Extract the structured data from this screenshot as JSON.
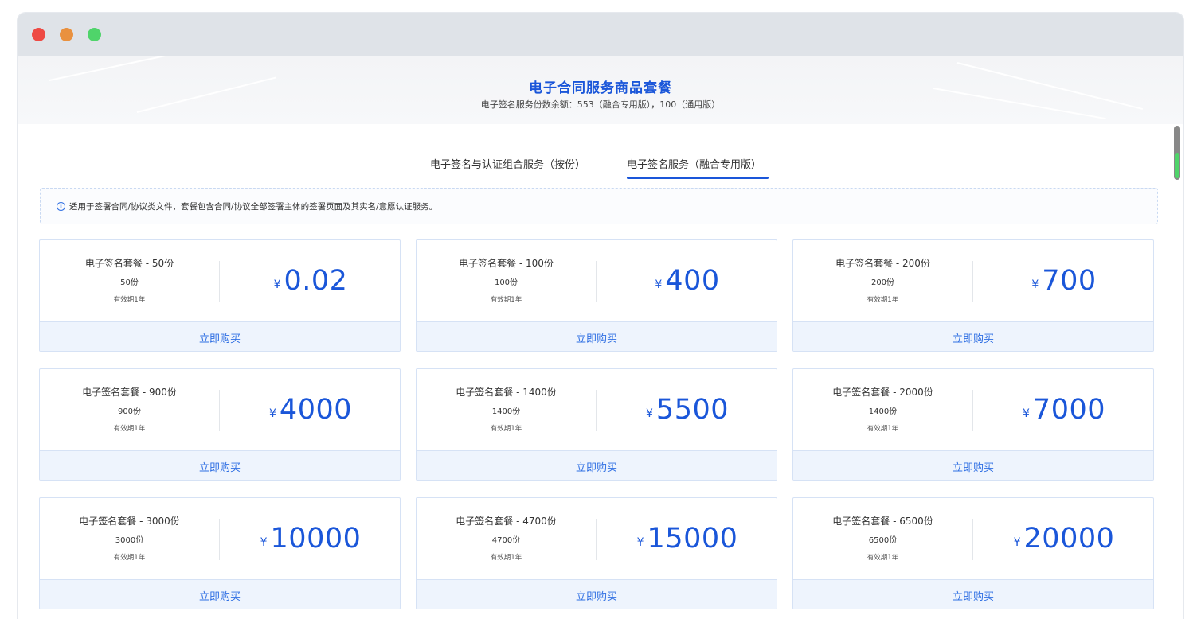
{
  "window": {
    "controls": [
      "close",
      "minimize",
      "maximize"
    ]
  },
  "banner": {
    "title": "电子合同服务商品套餐",
    "subtitle": "电子签名服务份数余额：553（融合专用版），100（通用版）"
  },
  "tabs": [
    {
      "label": "电子签名与认证组合服务（按份）",
      "active": false
    },
    {
      "label": "电子签名服务（融合专用版）",
      "active": true
    }
  ],
  "notice": {
    "icon": "info-icon",
    "text": "适用于签署合同/协议类文件，套餐包含合同/协议全部签署主体的签署页面及其实名/意愿认证服务。"
  },
  "currency_symbol": "¥",
  "packages": [
    {
      "name": "电子签名套餐 - 50份",
      "quantity": "50份",
      "validity": "有效期1年",
      "price": "0.02",
      "buy_label": "立即购买"
    },
    {
      "name": "电子签名套餐 - 100份",
      "quantity": "100份",
      "validity": "有效期1年",
      "price": "400",
      "buy_label": "立即购买"
    },
    {
      "name": "电子签名套餐 - 200份",
      "quantity": "200份",
      "validity": "有效期1年",
      "price": "700",
      "buy_label": "立即购买"
    },
    {
      "name": "电子签名套餐 - 900份",
      "quantity": "900份",
      "validity": "有效期1年",
      "price": "4000",
      "buy_label": "立即购买"
    },
    {
      "name": "电子签名套餐 - 1400份",
      "quantity": "1400份",
      "validity": "有效期1年",
      "price": "5500",
      "buy_label": "立即购买"
    },
    {
      "name": "电子签名套餐 - 2000份",
      "quantity": "1400份",
      "validity": "有效期1年",
      "price": "7000",
      "buy_label": "立即购买"
    },
    {
      "name": "电子签名套餐 - 3000份",
      "quantity": "3000份",
      "validity": "有效期1年",
      "price": "10000",
      "buy_label": "立即购买"
    },
    {
      "name": "电子签名套餐 - 4700份",
      "quantity": "4700份",
      "validity": "有效期1年",
      "price": "15000",
      "buy_label": "立即购买"
    },
    {
      "name": "电子签名套餐 - 6500份",
      "quantity": "6500份",
      "validity": "有效期1年",
      "price": "20000",
      "buy_label": "立即购买"
    }
  ],
  "colors": {
    "accent": "#1a56d9",
    "link": "#2f6fe3",
    "buy_bg": "#eef4fd",
    "titlebar": "#dfe3e8",
    "close": "#ee4a44",
    "minimize": "#e9913f",
    "maximize": "#4fd46a"
  }
}
